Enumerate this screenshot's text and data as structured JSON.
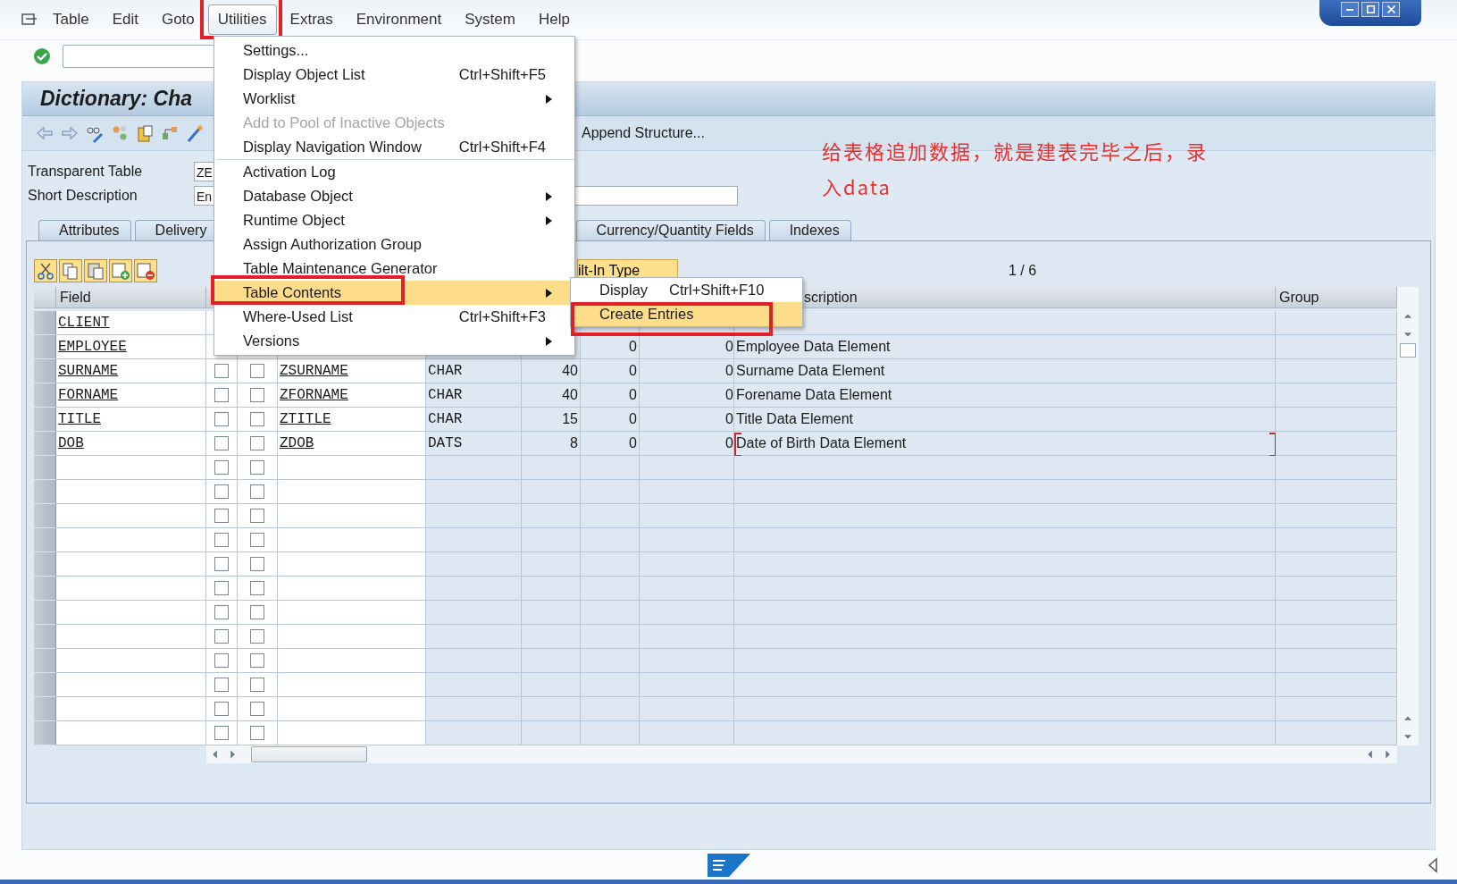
{
  "menu_bar": [
    {
      "label": "Table",
      "selected": false,
      "annotated": false
    },
    {
      "label": "Edit",
      "selected": false,
      "annotated": false
    },
    {
      "label": "Goto",
      "selected": false,
      "annotated": false
    },
    {
      "label": "Utilities",
      "selected": true,
      "annotated": true
    },
    {
      "label": "Extras",
      "selected": false,
      "annotated": false
    },
    {
      "label": "Environment",
      "selected": false,
      "annotated": false
    },
    {
      "label": "System",
      "selected": false,
      "annotated": false
    },
    {
      "label": "Help",
      "selected": false,
      "annotated": false
    }
  ],
  "utilities_menu": [
    {
      "kind": "item",
      "label": "Settings...",
      "submenu": false,
      "disabled": false,
      "selected": false,
      "annotated": false
    },
    {
      "kind": "item",
      "label": "Display Object List",
      "shortcut": "Ctrl+Shift+F5",
      "submenu": false,
      "disabled": false,
      "selected": false,
      "annotated": false
    },
    {
      "kind": "item",
      "label": "Worklist",
      "submenu": true,
      "disabled": false,
      "selected": false,
      "annotated": false
    },
    {
      "kind": "item",
      "label": "Add to Pool of Inactive Objects",
      "submenu": false,
      "disabled": true,
      "selected": false,
      "annotated": false
    },
    {
      "kind": "item",
      "label": "Display Navigation Window",
      "shortcut": "Ctrl+Shift+F4",
      "submenu": false,
      "disabled": false,
      "selected": false,
      "annotated": false
    },
    {
      "kind": "separator"
    },
    {
      "kind": "item",
      "label": "Activation Log",
      "submenu": false,
      "disabled": false,
      "selected": false,
      "annotated": false
    },
    {
      "kind": "item",
      "label": "Database Object",
      "submenu": true,
      "disabled": false,
      "selected": false,
      "annotated": false
    },
    {
      "kind": "item",
      "label": "Runtime Object",
      "submenu": true,
      "disabled": false,
      "selected": false,
      "annotated": false
    },
    {
      "kind": "item",
      "label": "Assign Authorization Group",
      "submenu": false,
      "disabled": false,
      "selected": false,
      "annotated": false
    },
    {
      "kind": "item",
      "label": "Table Maintenance Generator",
      "submenu": false,
      "disabled": false,
      "selected": false,
      "annotated": false
    },
    {
      "kind": "item",
      "label": "Table Contents",
      "submenu": true,
      "disabled": false,
      "selected": true,
      "annotated": true
    },
    {
      "kind": "item",
      "label": "Where-Used List",
      "shortcut": "Ctrl+Shift+F3",
      "submenu": false,
      "disabled": false,
      "selected": false,
      "annotated": false
    },
    {
      "kind": "item",
      "label": "Versions",
      "submenu": true,
      "disabled": false,
      "selected": false,
      "annotated": false
    }
  ],
  "table_contents_submenu": [
    {
      "label": "Display",
      "shortcut": "Ctrl+Shift+F10",
      "selected": false,
      "annotated": false
    },
    {
      "label": "Create Entries",
      "selected": true,
      "annotated": true
    }
  ],
  "title": "Dictionary: Cha",
  "append_button": "Append Structure...",
  "form": [
    {
      "label": "Transparent Table",
      "value": "ZE"
    },
    {
      "label": "Short Description",
      "value": "En"
    }
  ],
  "tabs": [
    {
      "label": "Attributes",
      "selected": false
    },
    {
      "label": "Delivery",
      "selected": false
    },
    {
      "label": "Currency/Quantity Fields",
      "selected": false
    },
    {
      "label": "Indexes",
      "selected": false
    }
  ],
  "table": {
    "partial_button": "ilt-In Type",
    "page_indicator": "1 / 6",
    "columns": {
      "field": "Field",
      "description": "scription",
      "group": "Group"
    },
    "rows": [
      {
        "field": "CLIENT",
        "focused": false
      },
      {
        "field": "EMPLOYEE",
        "decimals": "0",
        "short_decimals": "0",
        "description": "Employee Data Element",
        "focused": false
      },
      {
        "field": "SURNAME",
        "key": false,
        "initial": false,
        "data_element": "ZSURNAME",
        "data_type": "CHAR",
        "length": "40",
        "decimals": "0",
        "short_decimals": "0",
        "description": "Surname Data Element",
        "focused": false
      },
      {
        "field": "FORNAME",
        "key": false,
        "initial": false,
        "data_element": "ZFORNAME",
        "data_type": "CHAR",
        "length": "40",
        "decimals": "0",
        "short_decimals": "0",
        "description": "Forename Data Element",
        "focused": false
      },
      {
        "field": "TITLE",
        "key": false,
        "initial": false,
        "data_element": "ZTITLE",
        "data_type": "CHAR",
        "length": "15",
        "decimals": "0",
        "short_decimals": "0",
        "description": "Title Data Element",
        "focused": false
      },
      {
        "field": "DOB",
        "key": false,
        "initial": false,
        "data_element": "ZDOB",
        "data_type": "DATS",
        "length": "8",
        "decimals": "0",
        "short_decimals": "0",
        "description": "Date of Birth Data Element",
        "focused": true
      },
      {
        "key": false,
        "initial": false
      },
      {
        "key": false,
        "initial": false
      },
      {
        "key": false,
        "initial": false
      },
      {
        "key": false,
        "initial": false
      },
      {
        "key": false,
        "initial": false
      },
      {
        "key": false,
        "initial": false
      },
      {
        "key": false,
        "initial": false
      },
      {
        "key": false,
        "initial": false
      },
      {
        "key": false,
        "initial": false
      },
      {
        "key": false,
        "initial": false
      },
      {
        "key": false,
        "initial": false
      },
      {
        "key": false,
        "initial": false
      }
    ]
  },
  "annotation": "给表格追加数据，就是建表完毕之后，录入data"
}
